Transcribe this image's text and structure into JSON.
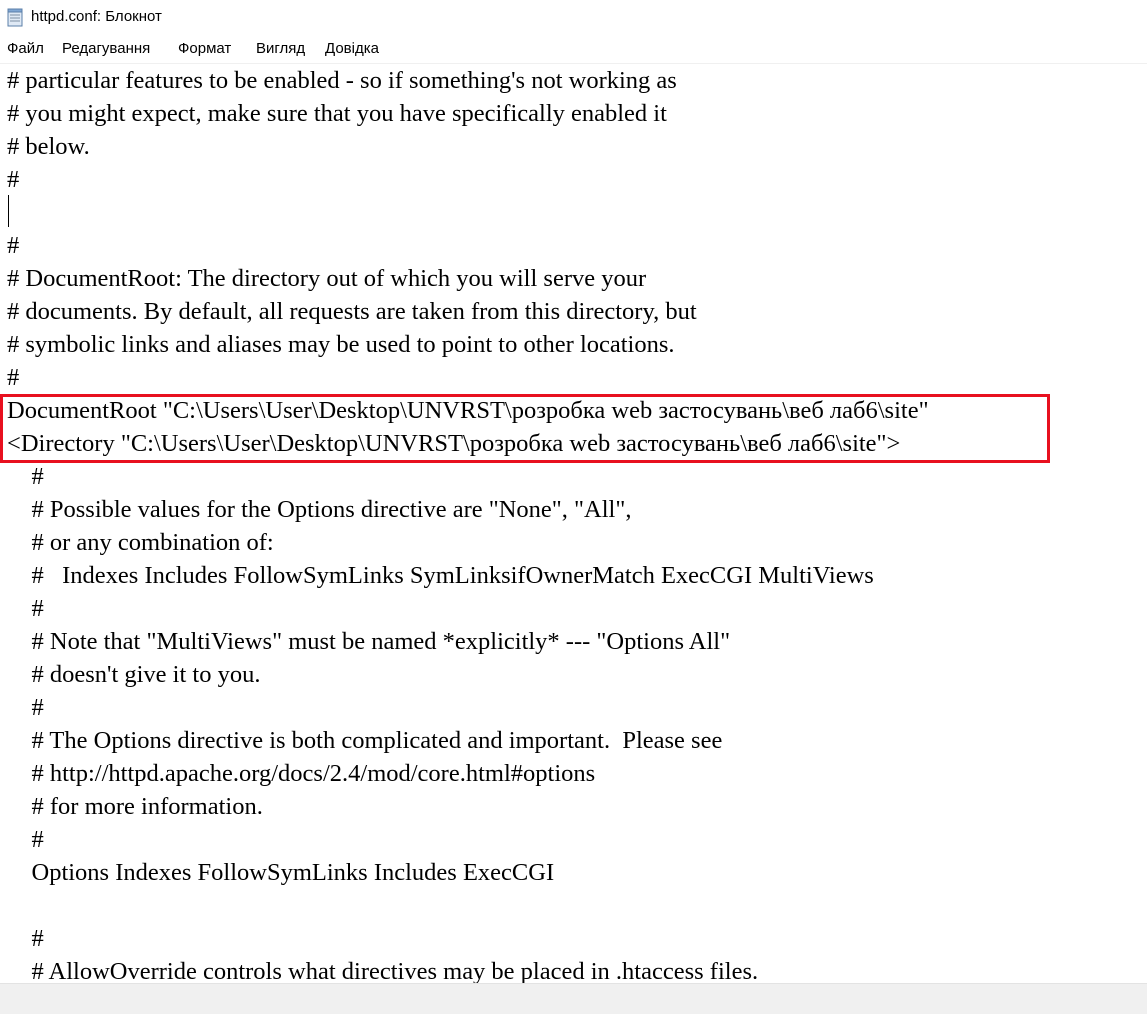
{
  "window": {
    "title": "httpd.conf: Блокнот",
    "icon": "notepad-icon"
  },
  "menu": {
    "items": [
      {
        "label": "Файл"
      },
      {
        "label": "Редагування"
      },
      {
        "label": "Формат"
      },
      {
        "label": "Вигляд"
      },
      {
        "label": "Довідка"
      }
    ]
  },
  "editor": {
    "highlight_color": "#e8101f",
    "lines": [
      "# particular features to be enabled - so if something's not working as",
      "# you might expect, make sure that you have specifically enabled it",
      "# below.",
      "#",
      "",
      "#",
      "# DocumentRoot: The directory out of which you will serve your",
      "# documents. By default, all requests are taken from this directory, but",
      "# symbolic links and aliases may be used to point to other locations.",
      "#",
      "DocumentRoot \"C:\\Users\\User\\Desktop\\UNVRST\\розробка web застосувань\\веб лаб6\\site\"",
      "<Directory \"C:\\Users\\User\\Desktop\\UNVRST\\розробка web застосувань\\веб лаб6\\site\">",
      "    #",
      "    # Possible values for the Options directive are \"None\", \"All\",",
      "    # or any combination of:",
      "    #   Indexes Includes FollowSymLinks SymLinksifOwnerMatch ExecCGI MultiViews",
      "    #",
      "    # Note that \"MultiViews\" must be named *explicitly* --- \"Options All\"",
      "    # doesn't give it to you.",
      "    #",
      "    # The Options directive is both complicated and important.  Please see",
      "    # http://httpd.apache.org/docs/2.4/mod/core.html#options",
      "    # for more information.",
      "    #",
      "    Options Indexes FollowSymLinks Includes ExecCGI",
      "",
      "    #",
      "    # AllowOverride controls what directives may be placed in .htaccess files."
    ]
  }
}
